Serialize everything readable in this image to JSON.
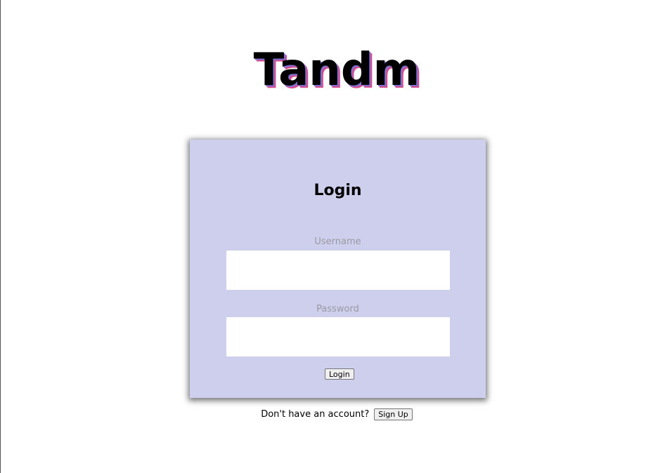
{
  "app": {
    "title": "Tandm"
  },
  "login_card": {
    "title": "Login",
    "username": {
      "label": "Username",
      "value": ""
    },
    "password": {
      "label": "Password",
      "value": ""
    },
    "submit_label": "Login"
  },
  "signup": {
    "prompt": "Don't have an account?",
    "button_label": "Sign Up"
  },
  "colors": {
    "card_background": "#cecfed",
    "title_shadow_purple": "#7e6fd0",
    "title_shadow_pink": "#d94a8c",
    "label_color": "#9a9aa4"
  }
}
